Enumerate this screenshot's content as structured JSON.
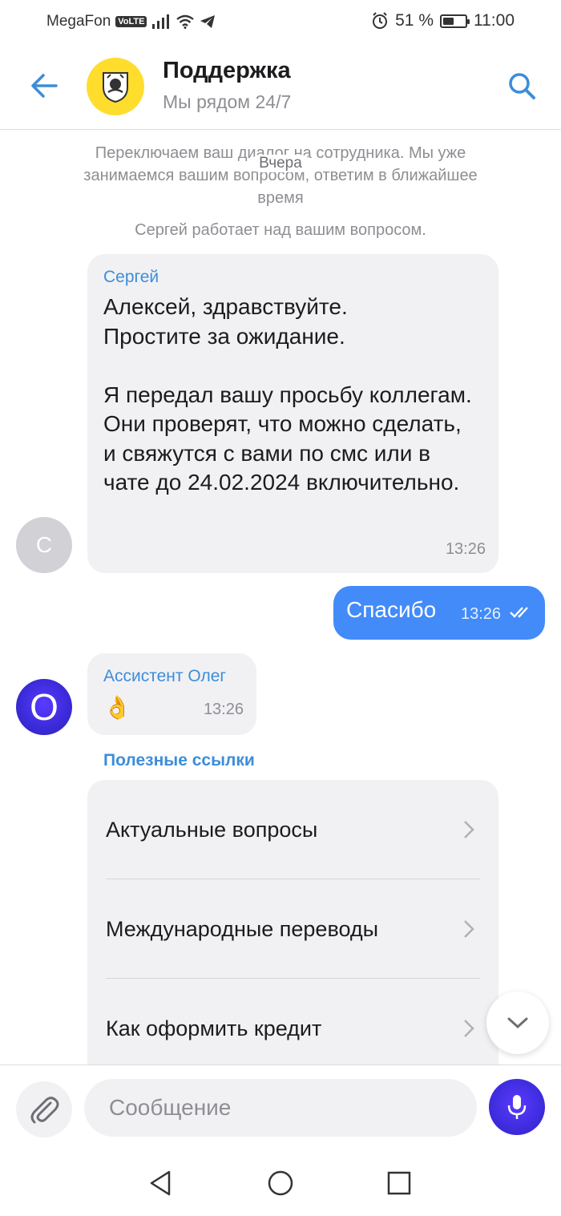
{
  "status_bar": {
    "carrier": "MegaFon",
    "volte": "VoLTE",
    "battery_text": "51 %",
    "battery_level": 0.51,
    "time": "11:00"
  },
  "header": {
    "title": "Поддержка",
    "subtitle": "Мы рядом 24/7",
    "accent_color": "#3d8dd8",
    "logo_color": "#ffdd2d"
  },
  "chat": {
    "system_message": "Переключаем ваш диалог на сотрудника. Мы уже занимаемся вашим вопросом, ответим в ближайшее время",
    "day_label": "Вчера",
    "status_message": "Сергей работает над вашим вопросом.",
    "messages": [
      {
        "avatar_letter": "С",
        "sender": "Сергей",
        "text": "Алексей, здравствуйте.\nПростите за ожидание.\n\nЯ передал вашу просьбу коллегам.\nОни проверят, что можно сделать, и свяжутся с вами по смс или в чате до 24.02.2024 включительно.",
        "time": "13:26"
      },
      {
        "outgoing": true,
        "text": "Спасибо",
        "time": "13:26",
        "color": "#428bf9"
      },
      {
        "avatar_letter": "O",
        "sender": "Ассистент Олег",
        "text": "👌",
        "time": "13:26"
      }
    ],
    "useful_links": {
      "title": "Полезные ссылки",
      "items": [
        {
          "label": "Актуальные вопросы"
        },
        {
          "label": "Международные переводы"
        },
        {
          "label": "Как оформить кредит"
        }
      ]
    }
  },
  "input": {
    "placeholder": "Сообщение"
  },
  "icons": {
    "back": "arrow-left-icon",
    "search": "search-icon",
    "attach": "paperclip-icon",
    "mic": "microphone-icon",
    "scroll": "chevron-down-icon"
  }
}
